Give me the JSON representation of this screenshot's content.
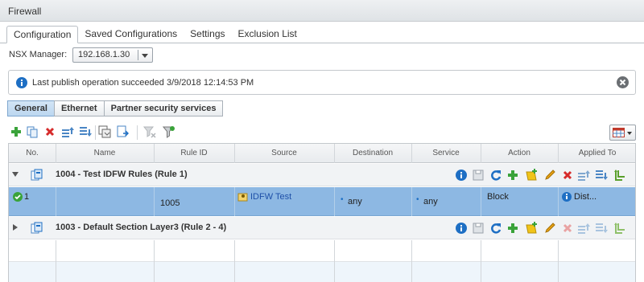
{
  "window": {
    "title": "Firewall"
  },
  "tabs": [
    "Configuration",
    "Saved Configurations",
    "Settings",
    "Exclusion List"
  ],
  "nsx": {
    "label": "NSX Manager:",
    "value": "192.168.1.30"
  },
  "info": {
    "message": "Last publish operation succeeded 3/9/2018 12:14:53 PM"
  },
  "subtabs": [
    "General",
    "Ethernet",
    "Partner security services"
  ],
  "grid": {
    "columns": [
      "No.",
      "Name",
      "Rule ID",
      "Source",
      "Destination",
      "Service",
      "Action",
      "Applied To"
    ],
    "sections": [
      {
        "title": "1004 - Test IDFW Rules (Rule 1)",
        "expanded": true
      },
      {
        "title": "1003 - Default Section Layer3 (Rule 2 - 4)",
        "expanded": false
      }
    ],
    "rule": {
      "number": "1",
      "name": "",
      "rule_id": "1005",
      "source": "IDFW Test",
      "destination": "any",
      "service": "any",
      "action": "Block",
      "applied_to": "Dist..."
    }
  },
  "colors": {
    "selected_row": "#8db8e3",
    "accent_blue": "#1e6fc4",
    "green": "#3aa33a",
    "red": "#d62b2b"
  }
}
